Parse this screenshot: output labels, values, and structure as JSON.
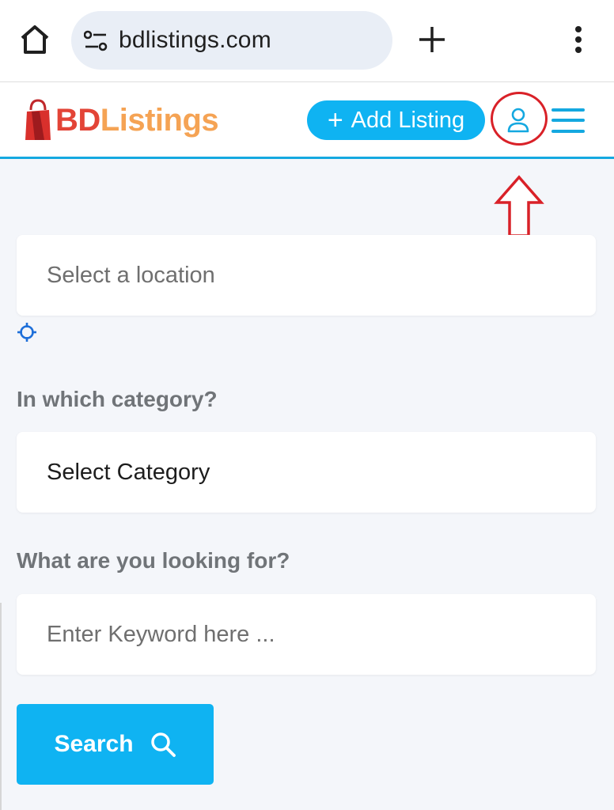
{
  "browser": {
    "url": "bdlistings.com"
  },
  "header": {
    "logo_part1": "BD",
    "logo_part2": "Listings",
    "add_listing_label": "Add Listing"
  },
  "form": {
    "location_placeholder": "Select a location",
    "category_label": "In which category?",
    "category_value": "Select Category",
    "keyword_label": "What are you looking for?",
    "keyword_placeholder": "Enter Keyword here ...",
    "search_label": "Search"
  },
  "colors": {
    "accent": "#0fb3f2",
    "header_border": "#14a8e0",
    "logo_red": "#e34437",
    "logo_orange": "#f5a354",
    "annotation": "#d92128",
    "background": "#f4f6fa"
  },
  "icons": {
    "home": "home-icon",
    "site_info": "tune-icon",
    "new_tab": "plus-icon",
    "more": "more-vertical-icon",
    "user": "user-icon",
    "menu": "hamburger-icon",
    "locate": "crosshair-icon",
    "search": "search-icon"
  }
}
